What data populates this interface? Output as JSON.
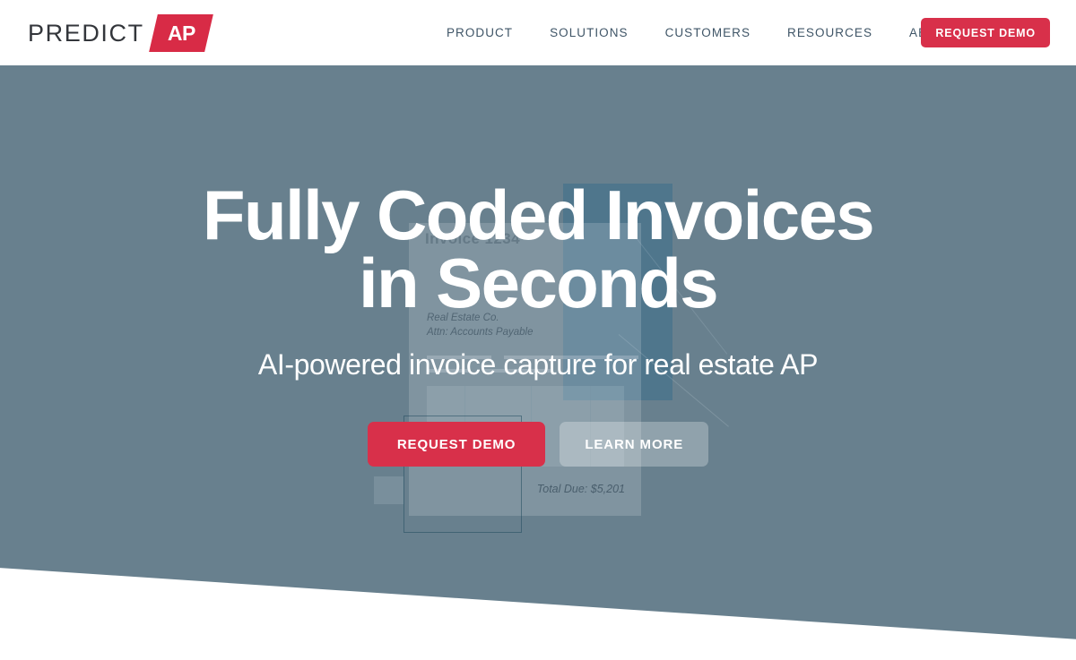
{
  "brand": {
    "word": "PREDICT",
    "mark": "AP",
    "accent_red": "#d8304a",
    "logo_text_color": "#33363b"
  },
  "header": {
    "nav": [
      {
        "label": "PRODUCT"
      },
      {
        "label": "SOLUTIONS"
      },
      {
        "label": "CUSTOMERS"
      },
      {
        "label": "RESOURCES"
      },
      {
        "label": "ABOUT"
      }
    ],
    "cta_label": "REQUEST DEMO"
  },
  "hero": {
    "background_color": "#68808e",
    "title_line1": "Fully Coded Invoices",
    "title_line2": "in Seconds",
    "subtitle": "AI-powered invoice capture for real estate AP",
    "primary_cta": "REQUEST DEMO",
    "secondary_cta": "LEARN MORE"
  },
  "background_invoice": {
    "title": "Invoice 1234",
    "recipient": "Real Estate Co.",
    "attention": "Attn: Accounts Payable",
    "total_due": "Total Due: $5,201",
    "blue_rect_color": "#45718c"
  }
}
